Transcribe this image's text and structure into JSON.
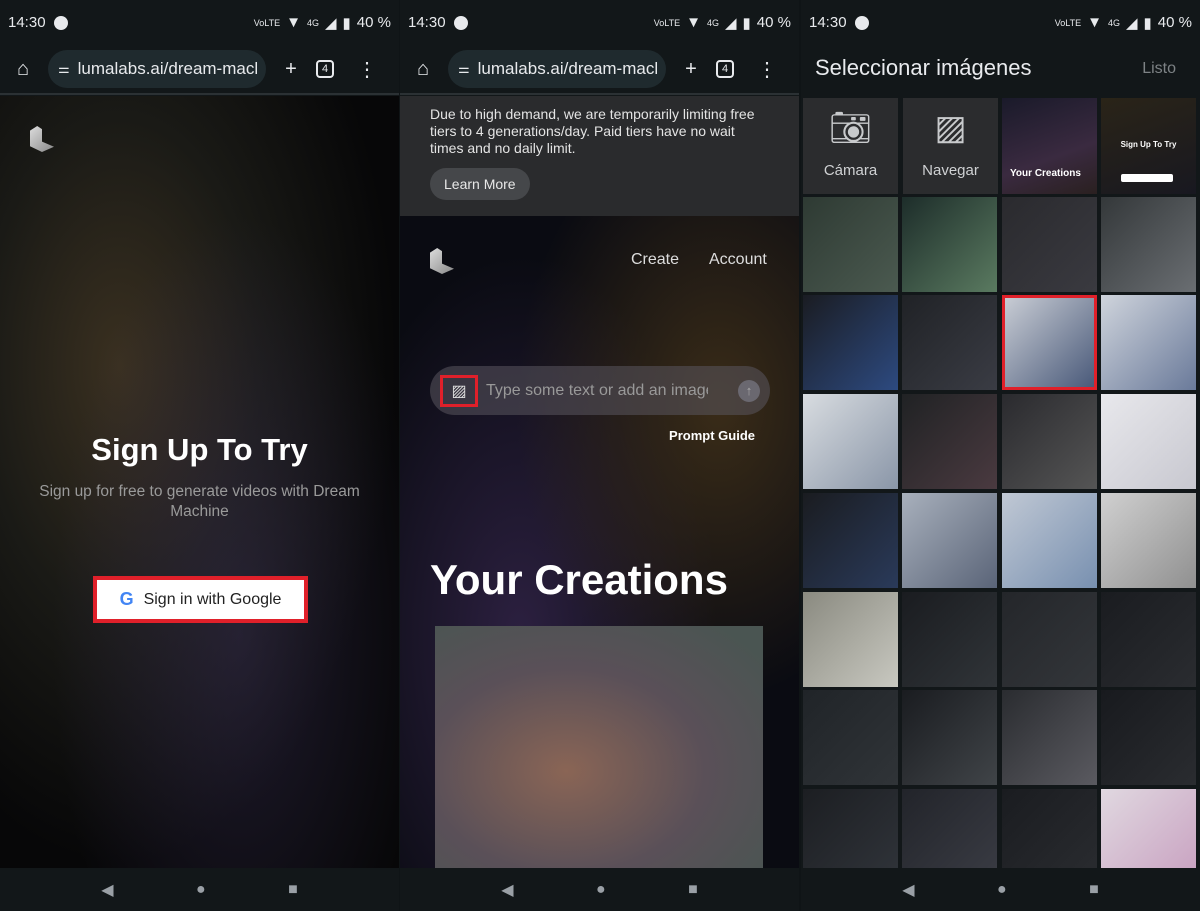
{
  "status": {
    "time": "14:30",
    "network": "VoLTE",
    "signal": "4G",
    "battery": "40 %"
  },
  "browser": {
    "url": "lumalabs.ai/dream-macl",
    "tab_count": "4"
  },
  "signup": {
    "title": "Sign Up To Try",
    "subtitle": "Sign up for free to generate videos with Dream Machine",
    "google_button": "Sign in with Google"
  },
  "create": {
    "banner": "Due to high demand, we are temporarily limiting free tiers to 4 generations/day. Paid tiers have no wait times and no daily limit.",
    "learn_more": "Learn More",
    "nav": [
      "Create",
      "Account"
    ],
    "input_placeholder": "Type some text or add an image",
    "prompt_guide": "Prompt Guide",
    "creations_title": "Your Creations"
  },
  "picker": {
    "title": "Seleccionar imágenes",
    "done": "Listo",
    "camera": "Cámara",
    "browse": "Navegar",
    "thumb_creations": "Your Creations",
    "thumb_signup": "Sign Up To Try"
  },
  "colors": {
    "highlight": "#e0202a",
    "google_button_bg": "#ffffff"
  }
}
